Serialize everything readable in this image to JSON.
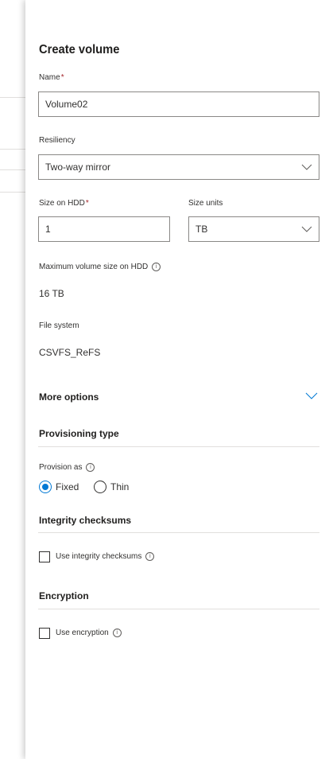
{
  "panel": {
    "title": "Create volume",
    "name_label": "Name",
    "required_mark": "*",
    "name_value": "Volume02",
    "resiliency_label": "Resiliency",
    "resiliency_value": "Two-way mirror",
    "size_label": "Size on HDD",
    "size_value": "1",
    "size_units_label": "Size units",
    "size_units_value": "TB",
    "max_size_label": "Maximum volume size on HDD",
    "max_size_value": "16 TB",
    "file_system_label": "File system",
    "file_system_value": "CSVFS_ReFS",
    "more_options": "More options",
    "provisioning_header": "Provisioning type",
    "provision_as_label": "Provision as",
    "provision_fixed": "Fixed",
    "provision_thin": "Thin",
    "provision_selected": "Fixed",
    "integrity_header": "Integrity checksums",
    "integrity_checkbox": "Use integrity checksums",
    "integrity_checked": false,
    "encryption_header": "Encryption",
    "encryption_checkbox": "Use encryption",
    "encryption_checked": false,
    "info_glyph": "i"
  },
  "colors": {
    "accent": "#0078d4",
    "required": "#a4262c",
    "border": "#8a8886"
  },
  "icons": [
    "chevron-down-icon",
    "info-icon"
  ]
}
